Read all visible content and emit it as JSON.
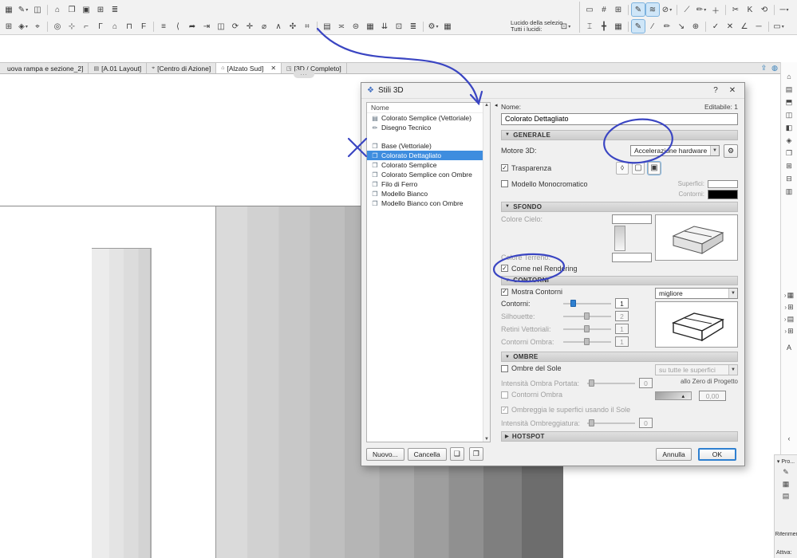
{
  "toolbar": {
    "row1_left": [
      {
        "g": "▦",
        "n": "grid-overlay-icon"
      },
      {
        "g": "✎",
        "n": "markup-pen-icon",
        "dd": true
      },
      {
        "g": "◫",
        "n": "trace-reference-icon"
      },
      {
        "sep": true,
        "n": "separator"
      },
      {
        "g": "⌂",
        "n": "home-view-icon"
      },
      {
        "g": "❐",
        "n": "windows-icon"
      },
      {
        "g": "▣",
        "n": "layout-book-icon"
      },
      {
        "g": "⊞",
        "n": "organizer-icon"
      },
      {
        "g": "≣",
        "n": "list-view-icon"
      }
    ],
    "row1_right": [
      {
        "g": "▭",
        "n": "marquee-icon"
      },
      {
        "g": "#",
        "n": "grid-snap-icon"
      },
      {
        "g": "⊞",
        "n": "snap-grid-icon"
      },
      {
        "sep": true,
        "n": "separator"
      },
      {
        "g": "✎",
        "n": "annotate-icon",
        "hl": true
      },
      {
        "g": "≋",
        "n": "layers-icon",
        "hl": true
      },
      {
        "g": "⊘",
        "n": "lock-icon",
        "dd": true
      },
      {
        "sep": true,
        "n": "separator"
      },
      {
        "g": "⟋",
        "n": "line-weight-icon"
      },
      {
        "g": "✏",
        "n": "pen-color-icon",
        "dd": true
      },
      {
        "g": "＋",
        "n": "add-icon"
      },
      {
        "sep": true,
        "n": "separator"
      },
      {
        "g": "✂",
        "n": "trim-icon"
      },
      {
        "g": "K",
        "n": "keyboard-shortcut-icon"
      },
      {
        "g": "⟲",
        "n": "undo-icon"
      },
      {
        "sep": true,
        "n": "separator"
      },
      {
        "g": "─",
        "n": "minus-icon",
        "dd": true
      }
    ],
    "row2_left": [
      {
        "g": "⊞",
        "n": "wall-tool-icon"
      },
      {
        "g": "◈",
        "n": "door-tool-icon",
        "dd": true
      },
      {
        "g": "⌖",
        "n": "origin-icon"
      },
      {
        "sep": true,
        "n": "separator"
      },
      {
        "g": "◎",
        "n": "zoom-tool-icon"
      },
      {
        "g": "⊹",
        "n": "snap-point-icon"
      },
      {
        "g": "⌐",
        "n": "corner-tool-icon"
      },
      {
        "g": "Γ",
        "n": "column-tool-icon"
      },
      {
        "g": "⌂",
        "n": "roof-tool-icon"
      },
      {
        "g": "⊓",
        "n": "beam-tool-icon"
      },
      {
        "g": "F",
        "n": "fill-tool-icon"
      },
      {
        "sep": true,
        "n": "separator"
      },
      {
        "g": "≡",
        "n": "slab-tool-icon"
      },
      {
        "g": "⟨",
        "n": "section-tool-icon"
      },
      {
        "g": "➦",
        "n": "elevation-tool-icon"
      },
      {
        "g": "⇥",
        "n": "detail-tool-icon"
      },
      {
        "g": "◫",
        "n": "worksheet-tool-icon"
      },
      {
        "g": "⟳",
        "n": "rotate-icon"
      },
      {
        "g": "✛",
        "n": "move-icon"
      },
      {
        "g": "⌀",
        "n": "circle-tool-icon"
      },
      {
        "g": "∧",
        "n": "polyline-tool-icon"
      },
      {
        "g": "✣",
        "n": "spline-tool-icon"
      },
      {
        "g": "⌗",
        "n": "hatch-tool-icon"
      },
      {
        "sep": true,
        "n": "separator"
      },
      {
        "g": "▤",
        "n": "zone-tool-icon"
      },
      {
        "g": "≍",
        "n": "dimension-tool-icon"
      },
      {
        "g": "⊜",
        "n": "label-tool-icon"
      },
      {
        "g": "▦",
        "n": "mesh-tool-icon"
      },
      {
        "g": "⇊",
        "n": "drop-icon"
      },
      {
        "g": "⊡",
        "n": "object-tool-icon"
      },
      {
        "g": "≣",
        "n": "schedule-icon"
      },
      {
        "sep": true,
        "n": "separator"
      },
      {
        "g": "⚙",
        "n": "settings-icon",
        "dd": true
      },
      {
        "g": "▦",
        "n": "layer-settings-icon"
      }
    ],
    "layer_line1": "Lucido della selezio",
    "layer_line2": "Tutti i lucidi:",
    "row2_after": [
      {
        "g": "⊡",
        "n": "quick-layers-icon",
        "dd": true
      }
    ],
    "row2_right": [
      {
        "g": "⌶",
        "n": "profile-icon"
      },
      {
        "g": "╋",
        "n": "intersect-icon"
      },
      {
        "g": "▦",
        "n": "grid-icon"
      },
      {
        "sep": true,
        "n": "separator"
      },
      {
        "g": "✎",
        "n": "edit-pen-icon",
        "hl": true
      },
      {
        "g": "∕",
        "n": "slash-tool-icon"
      },
      {
        "g": "✏",
        "n": "pencil-tool-icon"
      },
      {
        "g": "↘",
        "n": "offset-icon"
      },
      {
        "g": "⊕",
        "n": "add-node-icon"
      },
      {
        "sep": true,
        "n": "separator"
      },
      {
        "g": "✓",
        "n": "confirm-icon"
      },
      {
        "g": "✕",
        "n": "cancel-icon"
      },
      {
        "g": "∠",
        "n": "angle-icon"
      },
      {
        "g": "─",
        "n": "dash-icon"
      },
      {
        "sep": true,
        "n": "separator"
      },
      {
        "g": "▭",
        "n": "selection-box-icon",
        "dd": true
      }
    ]
  },
  "tabs": [
    {
      "label": "uova rampa e sezione_2]"
    },
    {
      "label": "[A.01 Layout]",
      "icon": "▤"
    },
    {
      "label": "[Centro di Azione]",
      "icon": "⌖",
      "spacer_before": true
    },
    {
      "label": "[Alzato Sud]",
      "icon": "⌂",
      "active": true,
      "close": "✕"
    },
    {
      "label": "[3D / Completo]",
      "icon": "◳"
    }
  ],
  "tabbar_icons": [
    {
      "g": "⇪",
      "n": "publish-icon"
    },
    {
      "g": "◍",
      "n": "teamwork-icon"
    }
  ],
  "canvas": {
    "note": "..."
  },
  "rail": {
    "top_icons": [
      {
        "g": "⌂",
        "n": "navigator-home-icon"
      },
      {
        "g": "▤",
        "n": "project-map-icon"
      },
      {
        "g": "⬒",
        "n": "view-map-icon"
      },
      {
        "g": "◫",
        "n": "layout-map-icon"
      },
      {
        "g": "◧",
        "n": "publisher-icon"
      },
      {
        "g": "◈",
        "n": "favorites-icon"
      },
      {
        "g": "❐",
        "n": "clone-folder-icon"
      },
      {
        "g": "⊞",
        "n": "expand-all-icon"
      },
      {
        "g": "⊟",
        "n": "collapse-all-icon"
      },
      {
        "g": "▥",
        "n": "properties-icon"
      }
    ],
    "tree_rows": [
      {
        "exp": "›",
        "g": "▦",
        "n": "tree-item-stories"
      },
      {
        "exp": "›",
        "g": "⊞",
        "n": "tree-item-sections"
      },
      {
        "exp": "›",
        "g": "▤",
        "n": "tree-item-elevations"
      },
      {
        "exp": "›",
        "g": "⊞",
        "n": "tree-item-details"
      }
    ],
    "letter_icon": "A",
    "collapse_icon": "‹",
    "panel": {
      "header": "Pro...",
      "icons": [
        {
          "g": "✎",
          "n": "edit-reference-icon"
        },
        {
          "g": "▦",
          "n": "reference-grid-icon"
        },
        {
          "g": "▤",
          "n": "reference-list-icon"
        }
      ],
      "riferimenti_label": "Riferimen...",
      "attiva_label": "Attiva:"
    }
  },
  "dialog": {
    "title": "Stili 3D",
    "help": "?",
    "close": "✕",
    "list": {
      "header": "Nome",
      "items_top": [
        {
          "label": "Colorato Semplice (Vettoriale)",
          "icon": "▤"
        },
        {
          "label": "Disegno Tecnico",
          "icon": "✏"
        }
      ],
      "items_main": [
        {
          "label": "Base (Vettoriale)",
          "icon": "❐"
        },
        {
          "label": "Colorato Dettagliato",
          "icon": "❐",
          "selected": true
        },
        {
          "label": "Colorato Semplice",
          "icon": "❐"
        },
        {
          "label": "Colorato Semplice con Ombre",
          "icon": "❐"
        },
        {
          "label": "Filo di Ferro",
          "icon": "❐"
        },
        {
          "label": "Modello Bianco",
          "icon": "❐"
        },
        {
          "label": "Modello Bianco con Ombre",
          "icon": "❐"
        }
      ],
      "new_button": "Nuovo...",
      "delete_button": "Cancella",
      "scroll_up": "▲",
      "scroll_down": "▼"
    },
    "name_label": "Nome:",
    "editable_label": "Editabile: 1",
    "name_value": "Colorato Dettagliato",
    "sections": {
      "generale": {
        "title": "GENERALE",
        "engine_label": "Motore 3D:",
        "engine_value": "Accelerazione hardware",
        "transparency_label": "Trasparenza",
        "transparency_checked": true,
        "mono_label": "Modello Monocromatico",
        "mono_checked": false,
        "surfaces_label": "Superfici:",
        "contours_label": "Contorni:",
        "mode_icons": [
          {
            "g": "⬨",
            "n": "shading-mode-icon"
          },
          {
            "g": "▢",
            "n": "sketch-mode-icon"
          },
          {
            "g": "▣",
            "n": "textured-mode-icon",
            "hl": true
          }
        ]
      },
      "sfondo": {
        "title": "SFONDO",
        "sky_label": "Colore Cielo:",
        "ground_label": "Colore Terreno:",
        "render_label": "Come nel Rendering",
        "render_checked": true
      },
      "contorni": {
        "title": "CONTORNI",
        "show_label": "Mostra Contorni",
        "show_checked": true,
        "quality_value": "migliore",
        "rows": [
          {
            "label": "Contorni:",
            "value": "1",
            "pos": 15,
            "on": true,
            "dis": false
          },
          {
            "label": "Silhouette:",
            "value": "2",
            "pos": 44,
            "on": false,
            "dis": true
          },
          {
            "label": "Retini Vettoriali:",
            "value": "1",
            "pos": 44,
            "on": false,
            "dis": true
          },
          {
            "label": "Contorni Ombra:",
            "value": "1",
            "pos": 44,
            "on": false,
            "dis": true
          }
        ]
      },
      "ombre": {
        "title": "OMBRE",
        "sun_label": "Ombre del Sole",
        "sun_checked": false,
        "sun_value": "su tutte le superfici",
        "intensity_label": "Intensità Ombra Portata:",
        "intensity_value": "0",
        "zero_label": "allo Zero di Progetto",
        "shadow_contours_label": "Contorni Ombra",
        "shadow_contours_checked": false,
        "shadow_contours_value": "0,00",
        "shade_label": "Ombreggia le superfici usando il Sole",
        "shade_checked": true,
        "shade_intensity_label": "Intensità Ombreggiatura:",
        "shade_intensity_value": "0"
      },
      "hotspot": {
        "title": "HOTSPOT"
      }
    },
    "cancel_button": "Annulla",
    "ok_button": "OK"
  }
}
